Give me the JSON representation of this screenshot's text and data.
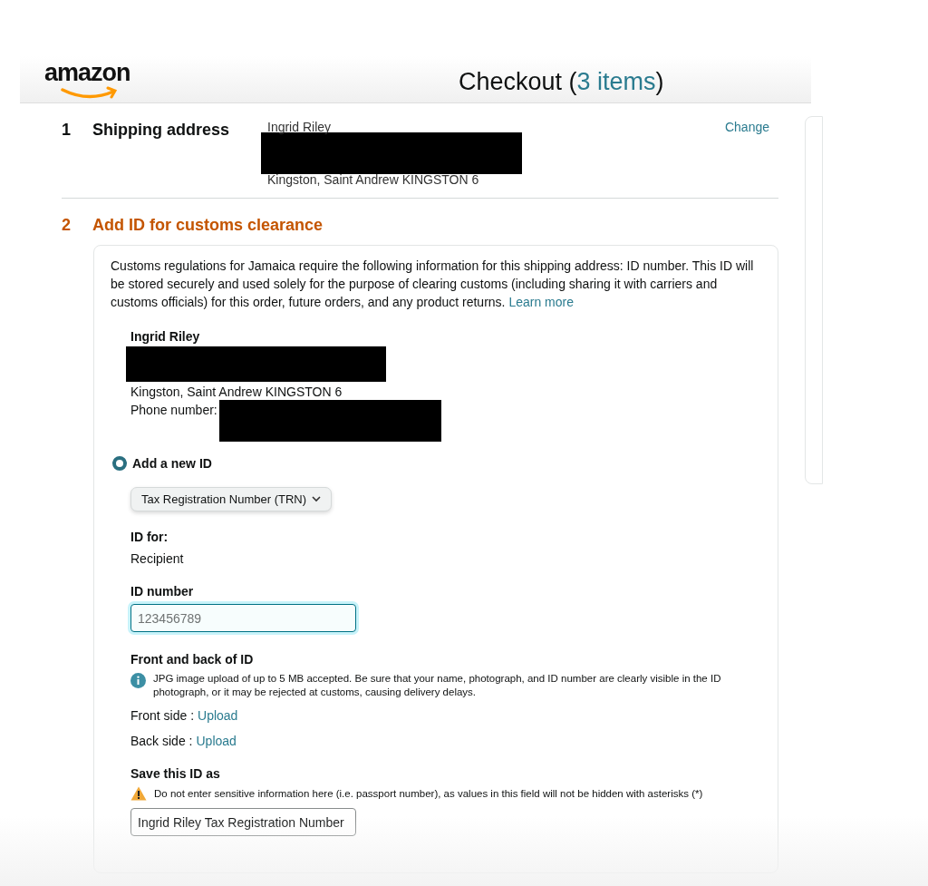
{
  "header": {
    "logo": "amazon",
    "title": "Checkout",
    "count_open": "(",
    "count": "3 items",
    "count_close": ")"
  },
  "sections": [
    {
      "number": "1",
      "title": "Shipping address",
      "active": false,
      "action": "Change",
      "address": [
        {
          "kind": "text",
          "text": "Ingrid Riley"
        },
        {
          "kind": "redacted"
        },
        {
          "kind": "text",
          "text": "Kingston, Saint Andrew KINGSTON 6"
        }
      ]
    },
    {
      "number": "2",
      "title": "Add ID for customs clearance",
      "active": true
    }
  ],
  "customs": {
    "intro": "Customs regulations for Jamaica require the following information for this shipping address: ID number. This ID will be stored securely and used solely for the purpose of clearing customs (including sharing it with carriers and customs officials) for this order, future orders, and any product returns.",
    "learn_more": "Learn more",
    "recipient_name": "Ingrid Riley",
    "city_line": "Kingston, Saint Andrew KINGSTON 6",
    "phone_label": "Phone number:",
    "radio": {
      "label": "Add a new ID",
      "selected": true
    },
    "id_type": "Tax Registration Number (TRN)",
    "id_for_label": "ID for:",
    "id_for_value": "Recipient",
    "id_number_label": "ID number",
    "id_number_placeholder": "123456789",
    "photo_label": "Front and back of ID",
    "photo_note": "JPG image upload of up to 5 MB accepted. Be sure that your name, photograph, and ID number are clearly visible in the ID photograph, or it may be rejected at customs, causing delivery delays.",
    "uploads": [
      {
        "label": "Front side :",
        "link": "Upload"
      },
      {
        "label": "Back side :",
        "link": "Upload"
      }
    ],
    "save_label": "Save this ID as",
    "save_warning": "Do not enter sensitive information here (i.e. passport number), as values in this field will not be hidden with asterisks (*)",
    "save_value": "Ingrid Riley Tax Registration Number"
  }
}
